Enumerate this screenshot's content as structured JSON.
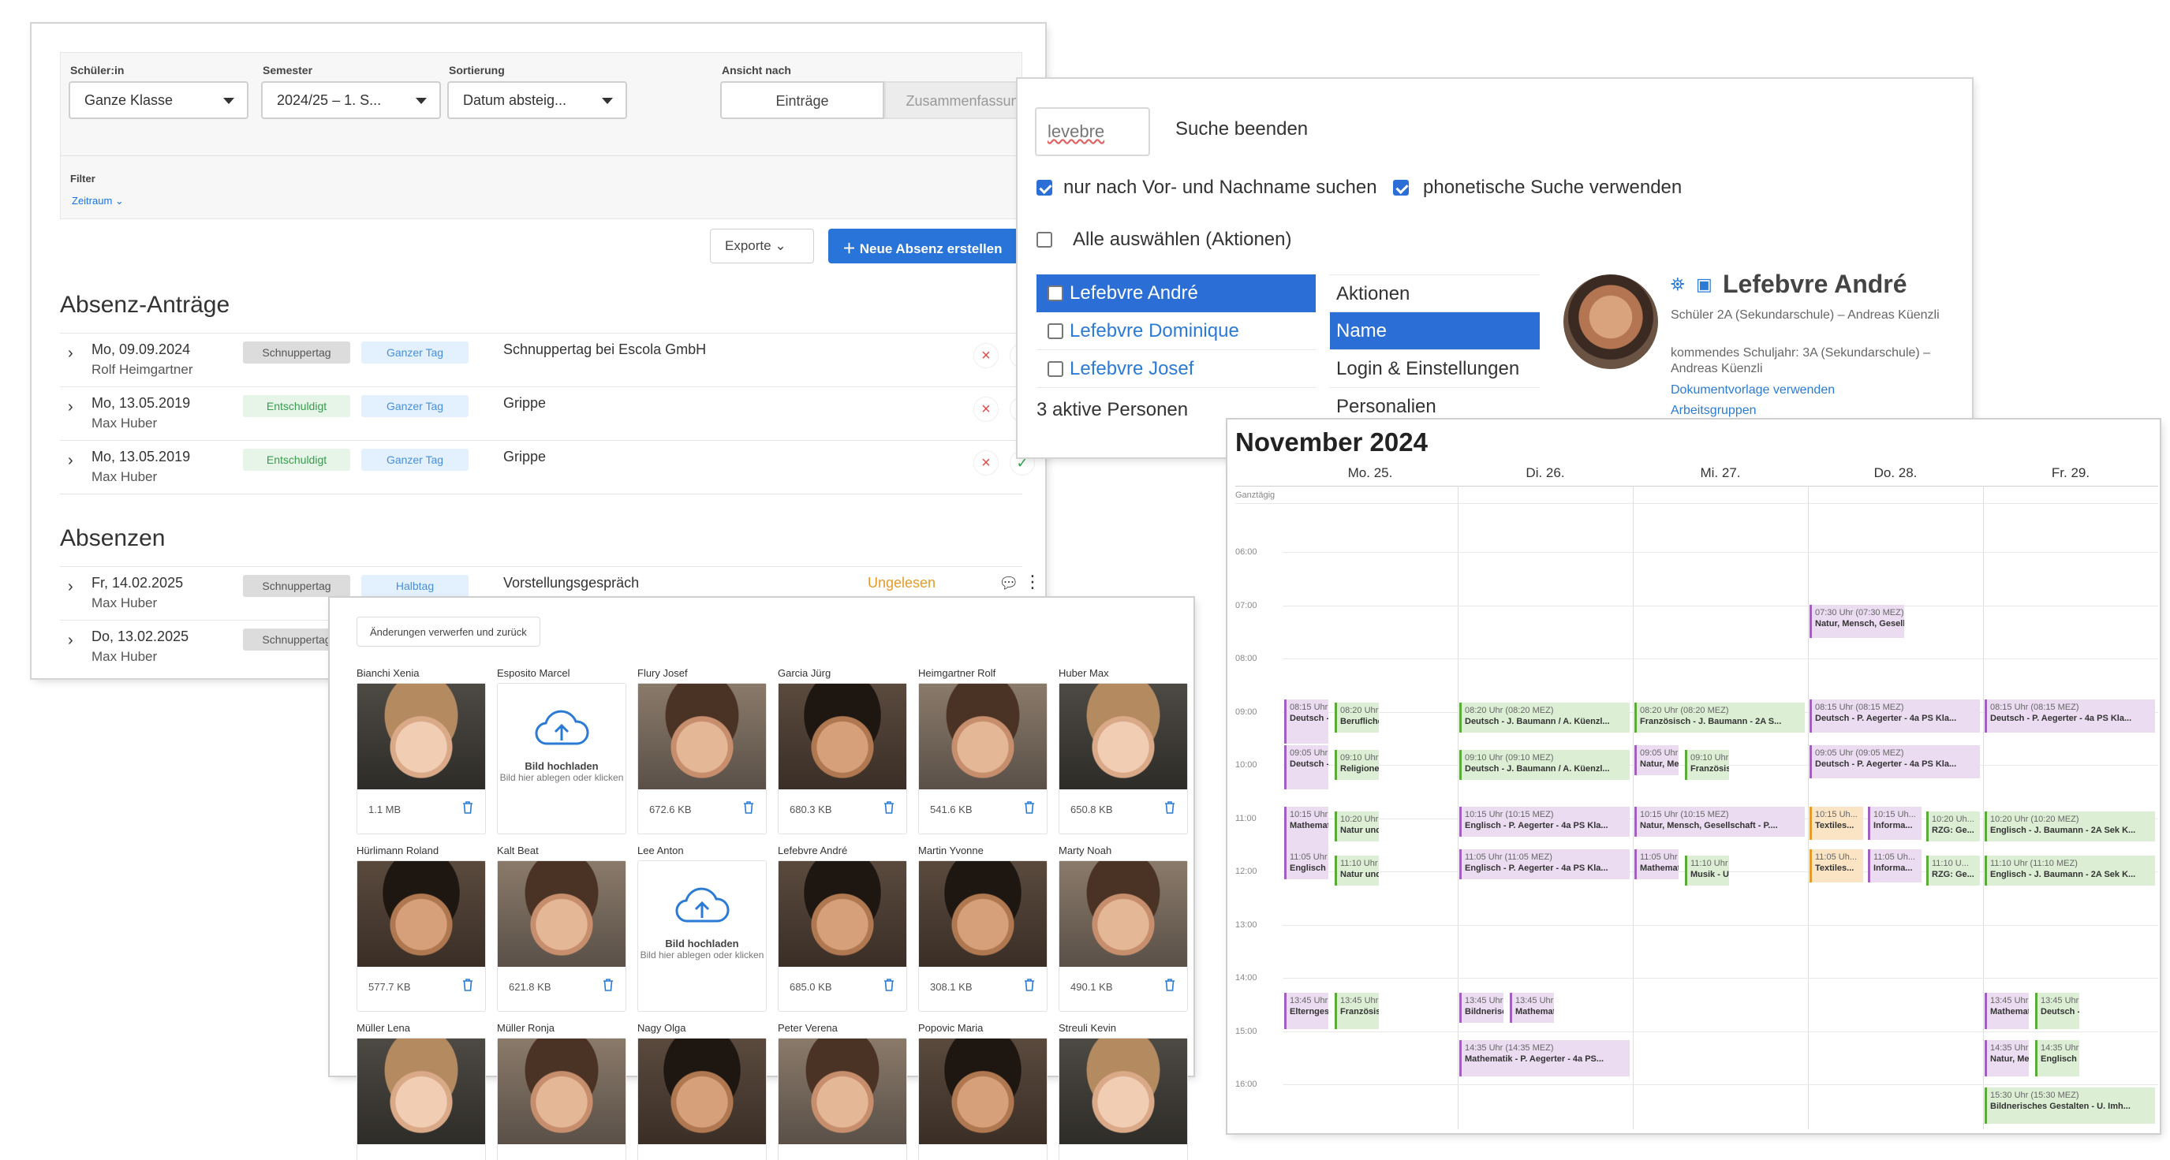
{
  "absences": {
    "filters": {
      "student_label": "Schüler:in",
      "student_value": "Ganze Klasse",
      "semester_label": "Semester",
      "semester_value": "2024/25 – 1. S...",
      "sort_label": "Sortierung",
      "sort_value": "Datum absteig...",
      "view_label": "Ansicht nach",
      "view_options": [
        "Einträge",
        "Zusammenfassung"
      ],
      "filter_label": "Filter",
      "filter_chip": "Zeitraum"
    },
    "export_label": "Exporte",
    "new_button": "Neue Absenz erstellen",
    "requests_title": "Absenz-Anträge",
    "requests": [
      {
        "date": "Mo, 09.09.2024",
        "who": "Rolf Heimgartner",
        "badge1": "Schnuppertag",
        "badge2": "Ganzer Tag",
        "desc": "Schnuppertag bei Escola GmbH"
      },
      {
        "date": "Mo, 13.05.2019",
        "who": "Max Huber",
        "badge1": "Entschuldigt",
        "badge2": "Ganzer Tag",
        "desc": "Grippe"
      },
      {
        "date": "Mo, 13.05.2019",
        "who": "Max Huber",
        "badge1": "Entschuldigt",
        "badge2": "Ganzer Tag",
        "desc": "Grippe"
      }
    ],
    "absences_title": "Absenzen",
    "absences": [
      {
        "date": "Fr, 14.02.2025",
        "who": "Max Huber",
        "badge1": "Schnuppertag",
        "badge2": "Halbtag",
        "desc": "Vorstellungsgespräch",
        "status": "Ungelesen"
      },
      {
        "date": "Do, 13.02.2025",
        "who": "Max Huber",
        "badge1": "Schnuppertag"
      }
    ]
  },
  "search": {
    "query": "levebre",
    "end_search": "Suche beenden",
    "opt_name_only": "nur nach Vor- und Nachname suchen",
    "opt_phonetic": "phonetische Suche verwenden",
    "select_all": "Alle auswählen (Aktionen)",
    "persons": [
      "Lefebvre André",
      "Lefebvre Dominique",
      "Lefebvre Josef"
    ],
    "active_count": "3 aktive Personen",
    "menu": [
      "Aktionen",
      "Name",
      "Login & Einstellungen",
      "Personalien"
    ],
    "profile": {
      "name": "Lefebvre André",
      "line1": "Schüler 2A (Sekundarschule) – Andreas Küenzli",
      "line2": "kommendes Schuljahr: 3A (Sekundarschule) – Andreas Küenzli",
      "link1": "Dokumentvorlage verwenden",
      "link2": "Arbeitsgruppen"
    }
  },
  "calendar": {
    "title": "November 2024",
    "days": [
      "Mo. 25.",
      "Di. 26.",
      "Mi. 27.",
      "Do. 28.",
      "Fr. 29."
    ],
    "allday": "Ganztägig",
    "hours": [
      "06:00",
      "07:00",
      "08:00",
      "09:00",
      "10:00",
      "11:00",
      "12:00",
      "13:00",
      "14:00",
      "15:00",
      "16:00"
    ],
    "events": [
      {
        "time": "07:30 Uhr (07:30 MEZ)",
        "name": "Natur, Mensch, Gesellschaft - P...."
      },
      {
        "time": "08:15 Uhr (08:1...",
        "name": "Deutsch - P. A..."
      },
      {
        "time": "08:20 Uhr (08:2...",
        "name": "Berufliche Ori..."
      },
      {
        "time": "08:20 Uhr (08:20 MEZ)",
        "name": "Deutsch - J. Baumann / A. Küenzl..."
      },
      {
        "time": "08:20 Uhr (08:20 MEZ)",
        "name": "Französisch - J. Baumann - 2A S..."
      },
      {
        "time": "08:15 Uhr (08:15 MEZ)",
        "name": "Deutsch - P. Aegerter - 4a PS Kla..."
      },
      {
        "time": "08:15 Uhr (08:15 MEZ)",
        "name": "Deutsch - P. Aegerter - 4a PS Kla..."
      },
      {
        "time": "09:05 Uhr (09:...",
        "name": "Deutsch - P. A..."
      },
      {
        "time": "09:10 Uhr (09:1...",
        "name": "Religionen, Ku..."
      },
      {
        "time": "09:10 Uhr (09:10 MEZ)",
        "name": "Deutsch - J. Baumann / A. Küenzl..."
      },
      {
        "time": "09:05 Uhr (09:...",
        "name": "Natur, Mensc..."
      },
      {
        "time": "09:10 Uhr (09:1...",
        "name": "Französisch -..."
      },
      {
        "time": "09:05 Uhr (09:05 MEZ)",
        "name": "Deutsch - P. Aegerter - 4a PS Kla..."
      },
      {
        "time": "10:15 Uhr (10:1...",
        "name": "Mathematik -..."
      },
      {
        "time": "10:20 Uhr (10:2...",
        "name": "Natur und Tec..."
      },
      {
        "time": "10:15 Uhr (10:15 MEZ)",
        "name": "Englisch - P. Aegerter - 4a PS Kla..."
      },
      {
        "time": "10:15 Uhr (10:15 MEZ)",
        "name": "Natur, Mensch, Gesellschaft - P...."
      },
      {
        "time": "10:15 Uh...",
        "name": "Textiles..."
      },
      {
        "time": "10:15 Uh...",
        "name": "Informa..."
      },
      {
        "time": "10:20 Uh...",
        "name": "RZG: Ge..."
      },
      {
        "time": "10:20 Uhr (10:20 MEZ)",
        "name": "Englisch - J. Baumann - 2A Sek K..."
      },
      {
        "time": "11:05 Uhr (11:0...",
        "name": "Englisch - P. A..."
      },
      {
        "time": "11:10 Uhr (11:10...",
        "name": "Natur und Tec..."
      },
      {
        "time": "11:05 Uhr (11:05 MEZ)",
        "name": "Englisch - P. Aegerter - 4a PS Kla..."
      },
      {
        "time": "11:05 Uhr (11:0...",
        "name": "Mathematik -..."
      },
      {
        "time": "11:10 Uhr (11:10...",
        "name": "Musik - U. Imh..."
      },
      {
        "time": "11:05 Uh...",
        "name": "Textiles..."
      },
      {
        "time": "11:05 Uh...",
        "name": "Informa..."
      },
      {
        "time": "11:10 U...",
        "name": "RZG: Ge..."
      },
      {
        "time": "11:10 Uhr (11:10 MEZ)",
        "name": "Englisch - J. Baumann - 2A Sek K..."
      },
      {
        "time": "13:45 Uhr (13:4...",
        "name": "Elterngespräch"
      },
      {
        "time": "13:45 Uhr (13:4...",
        "name": "Französisch -..."
      },
      {
        "time": "13:45 Uhr (13:4...",
        "name": "Bildnerisches..."
      },
      {
        "time": "13:45 Uhr (13:4...",
        "name": "Mathematik -..."
      },
      {
        "time": "13:45 Uhr (13:4...",
        "name": "Mathematik -..."
      },
      {
        "time": "13:45 Uhr (13:4...",
        "name": "Deutsch - J. B..."
      },
      {
        "time": "14:35 Uhr (14:35 MEZ)",
        "name": "Mathematik - P. Aegerter - 4a PS..."
      },
      {
        "time": "14:35 Uhr (14:3...",
        "name": "Natur, Mensc..."
      },
      {
        "time": "14:35 Uhr (14:3...",
        "name": "Englisch - J. B..."
      },
      {
        "time": "15:30 Uhr (15:30 MEZ)",
        "name": "Bildnerisches Gestalten - U. Imh..."
      }
    ]
  },
  "photos": {
    "discard_button": "Änderungen verwerfen und zurück",
    "upload_title": "Bild hochladen",
    "upload_sub": "Bild hier ablegen oder klicken",
    "cards": [
      {
        "name": "Bianchi Xenia",
        "size": "1.1 MB"
      },
      {
        "name": "Esposito Marcel",
        "size": ""
      },
      {
        "name": "Flury Josef",
        "size": "672.6 KB"
      },
      {
        "name": "Garcia Jürg",
        "size": "680.3 KB"
      },
      {
        "name": "Heimgartner Rolf",
        "size": "541.6 KB"
      },
      {
        "name": "Huber Max",
        "size": "650.8 KB"
      },
      {
        "name": "Hürlimann Roland",
        "size": "577.7 KB"
      },
      {
        "name": "Kalt Beat",
        "size": "621.8 KB"
      },
      {
        "name": "Lee Anton",
        "size": ""
      },
      {
        "name": "Lefebvre André",
        "size": "685.0 KB"
      },
      {
        "name": "Martin Yvonne",
        "size": "308.1 KB"
      },
      {
        "name": "Marty Noah",
        "size": "490.1 KB"
      },
      {
        "name": "Müller Lena",
        "size": ""
      },
      {
        "name": "Müller Ronja",
        "size": ""
      },
      {
        "name": "Nagy Olga",
        "size": ""
      },
      {
        "name": "Peter Verena",
        "size": ""
      },
      {
        "name": "Popovic Maria",
        "size": ""
      },
      {
        "name": "Streuli Kevin",
        "size": ""
      }
    ]
  },
  "colors": {
    "primary": "#2874d8",
    "link": "#2b7bd6",
    "danger": "#e24a4a",
    "success": "#2da44e",
    "warning": "#e59a2a"
  }
}
